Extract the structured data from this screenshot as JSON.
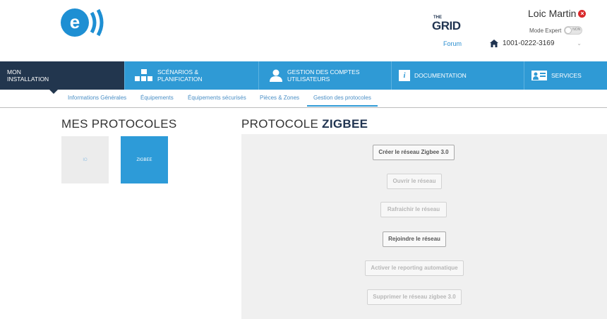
{
  "header": {
    "logo_letter": "e",
    "grid_logo_small": "THE",
    "grid_logo_big": "GRID",
    "forum_label": "Forum",
    "user_name": "Loic Martin",
    "mode_label": "Mode Expert",
    "mode_toggle_text": "NON",
    "mode_expert_on": false,
    "installation_id": "1001-0222-3169"
  },
  "nav": {
    "items": [
      {
        "line1": "MON",
        "line2": "INSTALLATION",
        "icon": "none"
      },
      {
        "line1": "SCÉNARIOS &",
        "line2": "PLANIFICATION",
        "icon": "scenario-blocks-icon"
      },
      {
        "line1": "GESTION DES COMPTES",
        "line2": "UTILISATEURS",
        "icon": "user-icon"
      },
      {
        "line1": "DOCUMENTATION",
        "line2": "",
        "icon": "info-icon"
      },
      {
        "line1": "SERVICES",
        "line2": "",
        "icon": "services-icon"
      }
    ]
  },
  "subnav": {
    "items": [
      {
        "label": "Informations Générales"
      },
      {
        "label": "Équipements"
      },
      {
        "label": "Équipements sécurisés"
      },
      {
        "label": "Pièces & Zones"
      },
      {
        "label": "Gestion des protocoles"
      }
    ],
    "active_index": 4
  },
  "left": {
    "title": "MES PROTOCOLES",
    "tiles": [
      {
        "label": "IO"
      },
      {
        "label": "ZIGBEE"
      }
    ]
  },
  "right": {
    "title_prefix": "PROTOCOLE",
    "title_bold": "ZIGBEE",
    "buttons": [
      {
        "label": "Créer le réseau Zigbee 3.0",
        "enabled": true
      },
      {
        "label": "Ouvrir le réseau",
        "enabled": false
      },
      {
        "label": "Rafraichir le réseau",
        "enabled": false
      },
      {
        "label": "Rejoindre le réseau",
        "enabled": true
      },
      {
        "label": "Activer le reporting automatique",
        "enabled": false
      },
      {
        "label": "Supprimer le réseau zigbee 3.0",
        "enabled": false
      }
    ]
  },
  "colors": {
    "nav_active": "#22364e",
    "nav_blue": "#2f9ad5",
    "brand_blue": "#1e8fd3",
    "grid_navy": "#1f3350",
    "alert_red": "#d9292b"
  }
}
